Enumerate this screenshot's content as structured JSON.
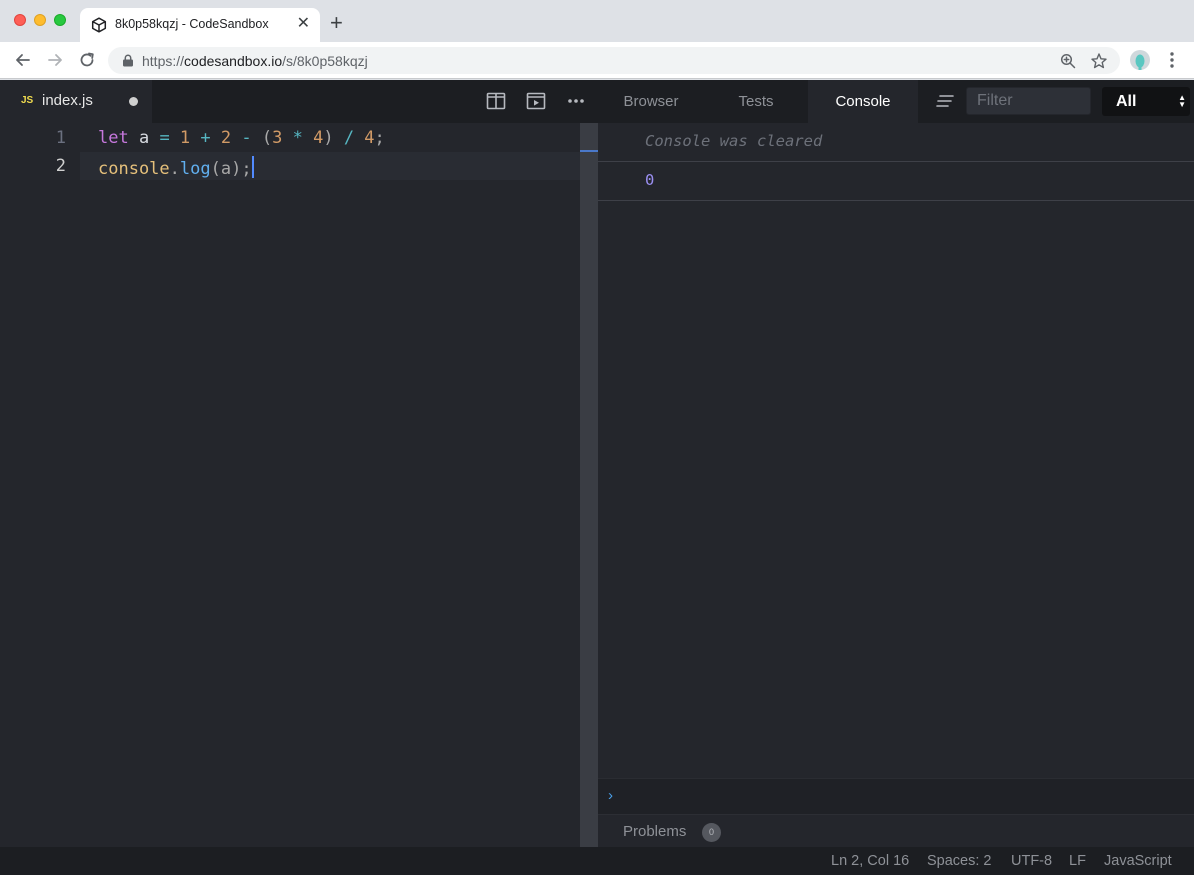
{
  "browser": {
    "tab_title": "8k0p58kqzj - CodeSandbox",
    "tab_favicon": "codesandbox-cube-icon",
    "url_scheme": "https://",
    "url_host": "codesandbox.io",
    "url_path": "/s/8k0p58kqzj"
  },
  "editor": {
    "file_tab": {
      "badge": "JS",
      "name": "index.js",
      "unsaved": true
    },
    "header_icons": [
      "split-view-icon",
      "preview-icon",
      "more-icon"
    ],
    "line_numbers": [
      "1",
      "2"
    ],
    "lines": [
      {
        "tokens": [
          {
            "text": "let",
            "kind": "keyword"
          },
          {
            "text": " a ",
            "kind": "plain"
          },
          {
            "text": "=",
            "kind": "operator"
          },
          {
            "text": " 1 ",
            "kind": "number"
          },
          {
            "text": "+",
            "kind": "operator"
          },
          {
            "text": " 2 ",
            "kind": "number"
          },
          {
            "text": "-",
            "kind": "operator"
          },
          {
            "text": " (",
            "kind": "paren"
          },
          {
            "text": "3",
            "kind": "number"
          },
          {
            "text": " * ",
            "kind": "operator"
          },
          {
            "text": "4",
            "kind": "number"
          },
          {
            "text": ")",
            "kind": "paren"
          },
          {
            "text": " / ",
            "kind": "operator"
          },
          {
            "text": "4",
            "kind": "number"
          },
          {
            "text": ";",
            "kind": "paren"
          }
        ]
      },
      {
        "tokens": [
          {
            "text": "console",
            "kind": "object"
          },
          {
            "text": ".",
            "kind": "paren"
          },
          {
            "text": "log",
            "kind": "function"
          },
          {
            "text": "(a);",
            "kind": "paren"
          }
        ]
      }
    ]
  },
  "panel": {
    "tabs": [
      {
        "label": "Browser",
        "active": false
      },
      {
        "label": "Tests",
        "active": false
      },
      {
        "label": "Console",
        "active": true
      }
    ],
    "filter_placeholder": "Filter",
    "level_select": "All",
    "console": {
      "cleared_message": "Console was cleared",
      "output": "0",
      "prompt": "›"
    },
    "problems": {
      "label": "Problems",
      "count": "0"
    }
  },
  "statusbar": {
    "position": "Ln 2, Col 16",
    "spaces": "Spaces: 2",
    "encoding": "UTF-8",
    "eol": "LF",
    "language": "JavaScript"
  },
  "colors": {
    "keyword": "#c678dd",
    "operator": "#56b6c2",
    "number": "#d19a66",
    "object": "#e5c07b",
    "function": "#61afef",
    "console_value": "#9b8ff2",
    "cursor": "#528bff"
  }
}
